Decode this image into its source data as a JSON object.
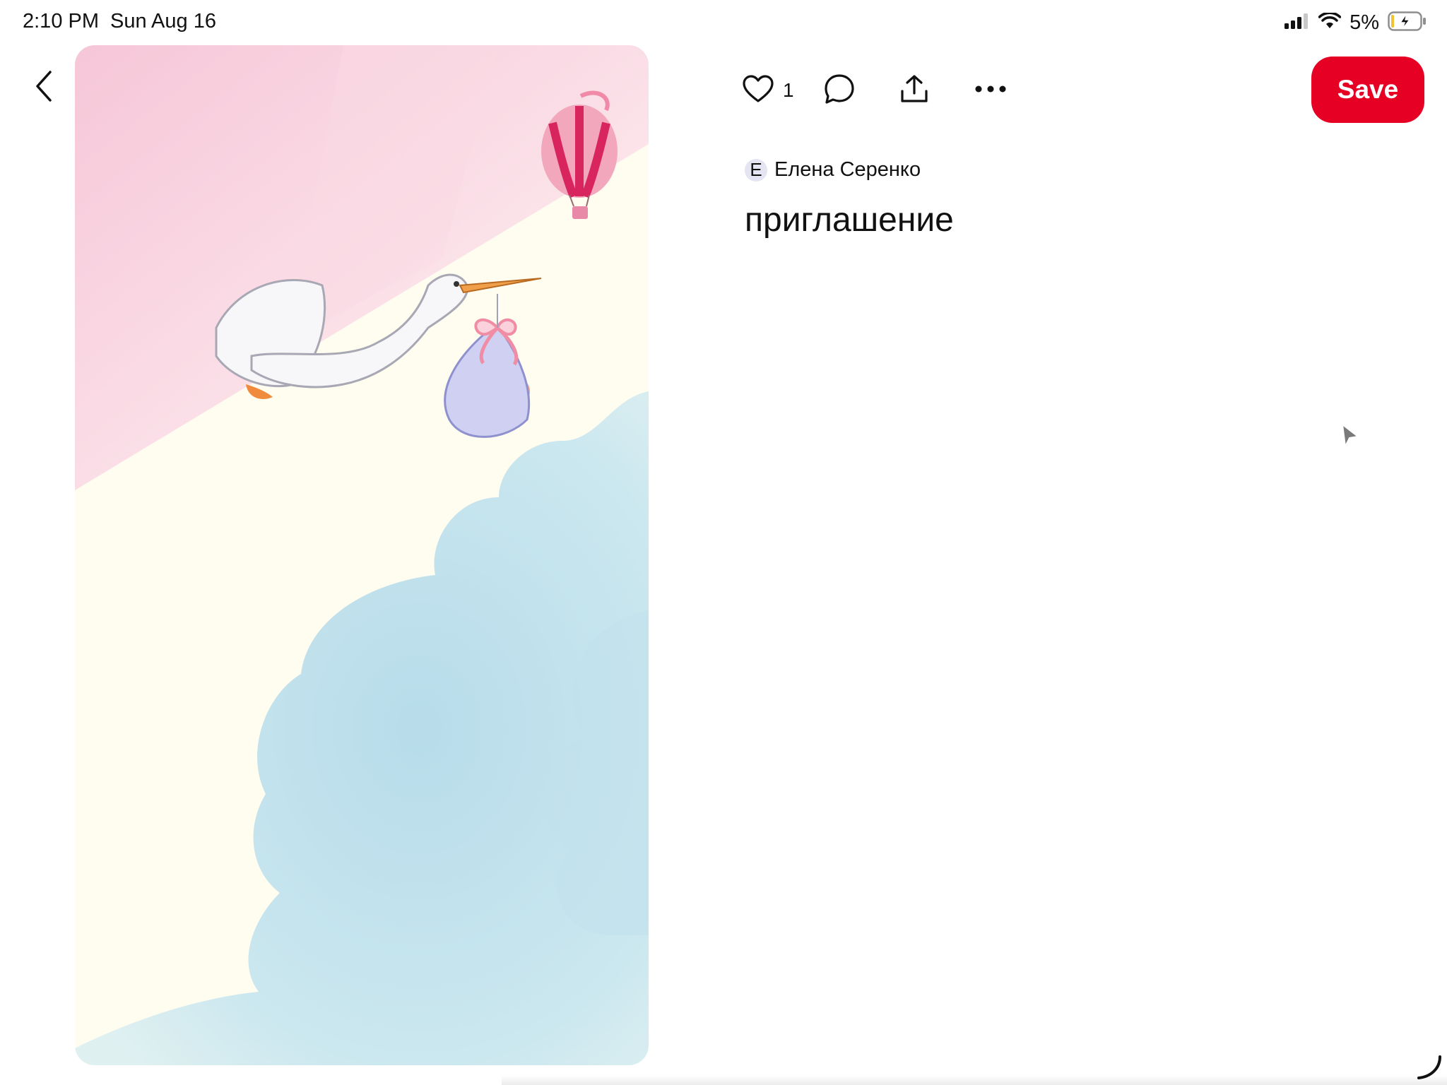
{
  "status_bar": {
    "time": "2:10 PM",
    "date": "Sun Aug 16",
    "battery_percent": "5%",
    "icons": [
      "signal-icon",
      "wifi-icon",
      "battery-charging-icon"
    ]
  },
  "navigation": {
    "back_icon": "chevron-left-icon"
  },
  "pin": {
    "image_icons": [
      "stork-illustration",
      "hot-air-balloon-illustration",
      "baby-bundle-illustration"
    ],
    "like_count": "1",
    "save_label": "Save",
    "author": {
      "avatar_letter": "E",
      "name": "Елена Серенко"
    },
    "title": "приглашение"
  },
  "actions": {
    "icons": [
      "heart-icon",
      "comment-icon",
      "share-icon",
      "more-icon"
    ]
  },
  "colors": {
    "save_button": "#e60023",
    "background": "#ffffff",
    "text": "#111111"
  }
}
